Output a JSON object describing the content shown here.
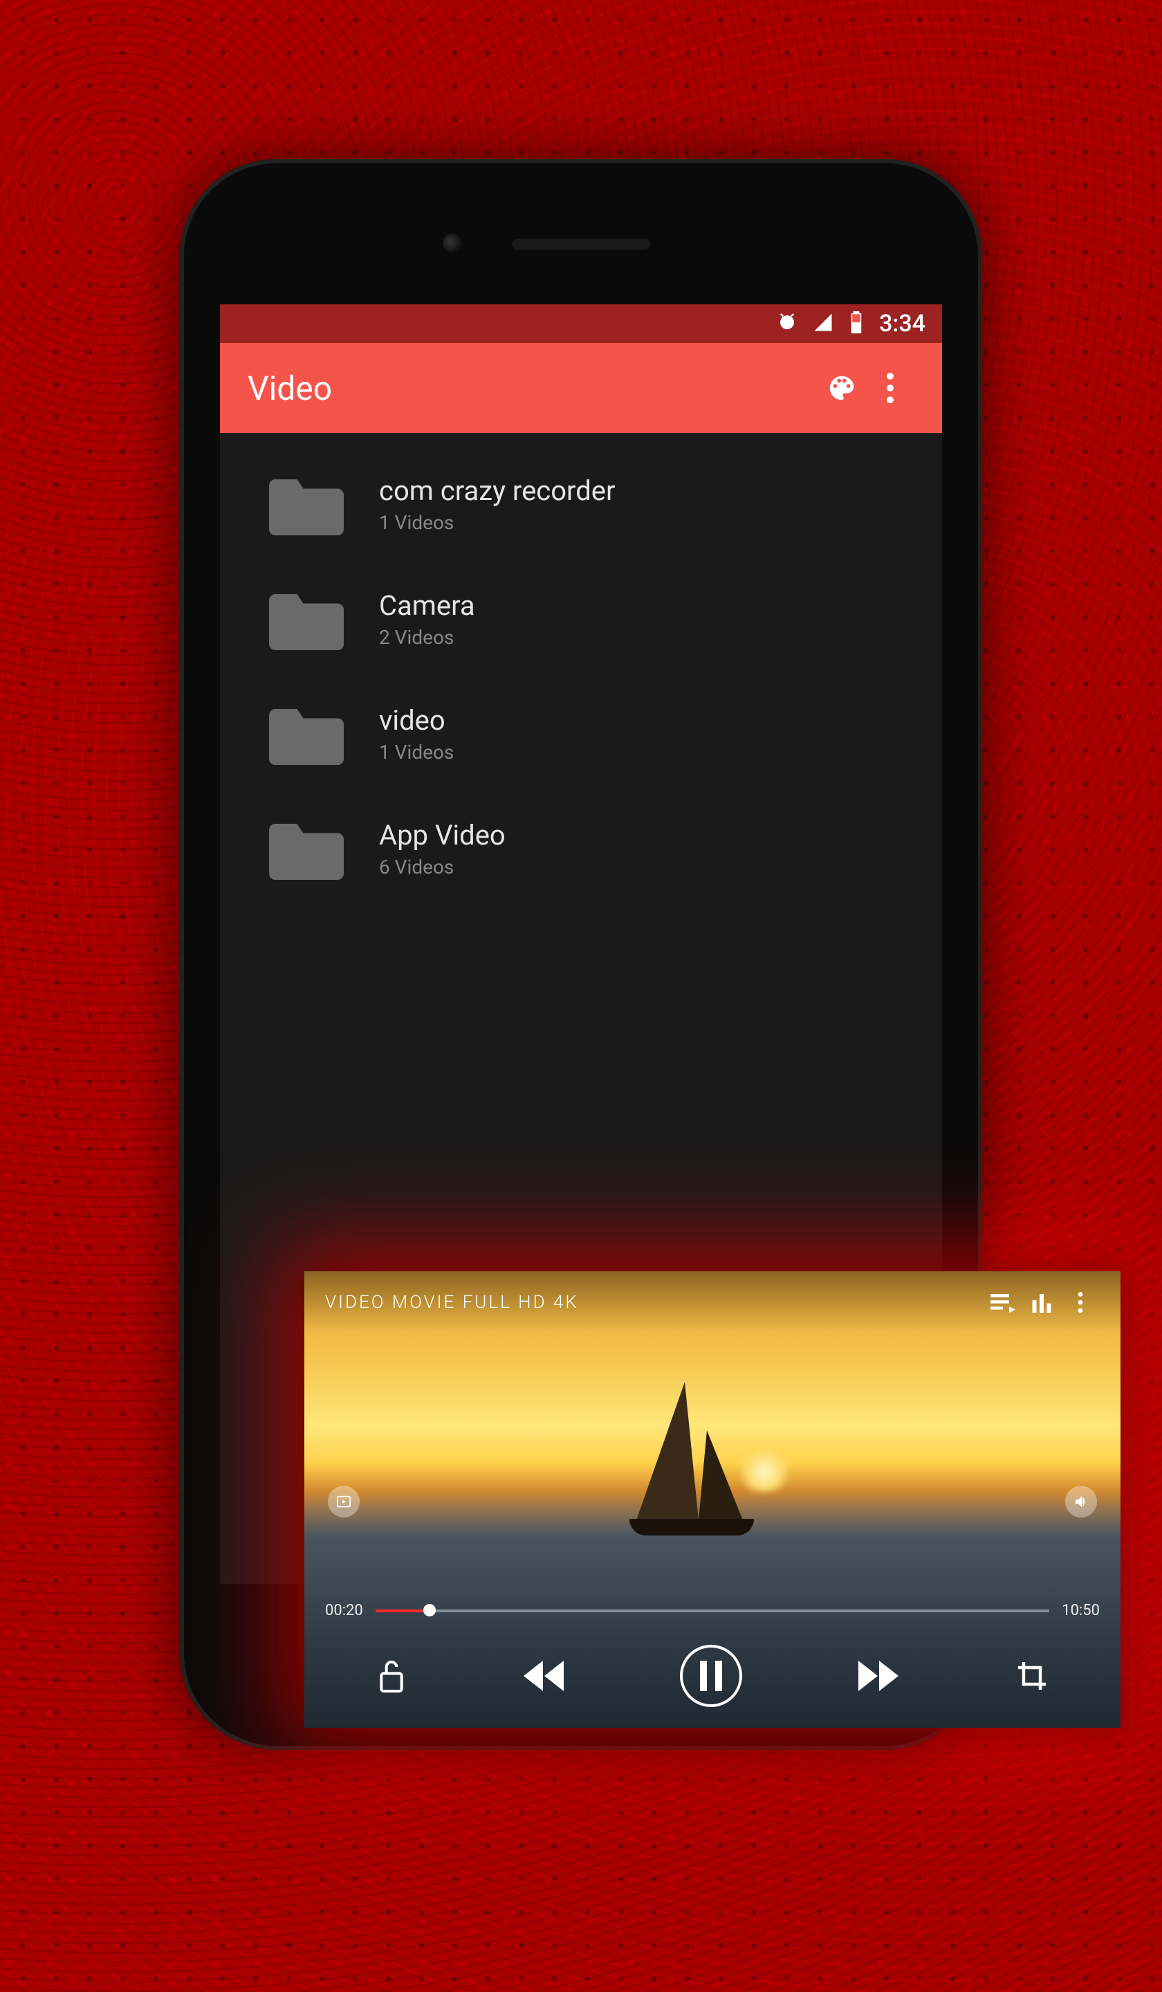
{
  "statusbar": {
    "time": "3:34"
  },
  "appbar": {
    "title": "Video"
  },
  "folders": [
    {
      "name": "com crazy recorder",
      "count": "1 Videos"
    },
    {
      "name": "Camera",
      "count": "2 Videos"
    },
    {
      "name": "video",
      "count": "1 Videos"
    },
    {
      "name": "App Video",
      "count": "6 Videos"
    }
  ],
  "player": {
    "title": "VIDEO MOVIE FULL HD 4K",
    "current_time": "00:20",
    "duration": "10:50"
  }
}
